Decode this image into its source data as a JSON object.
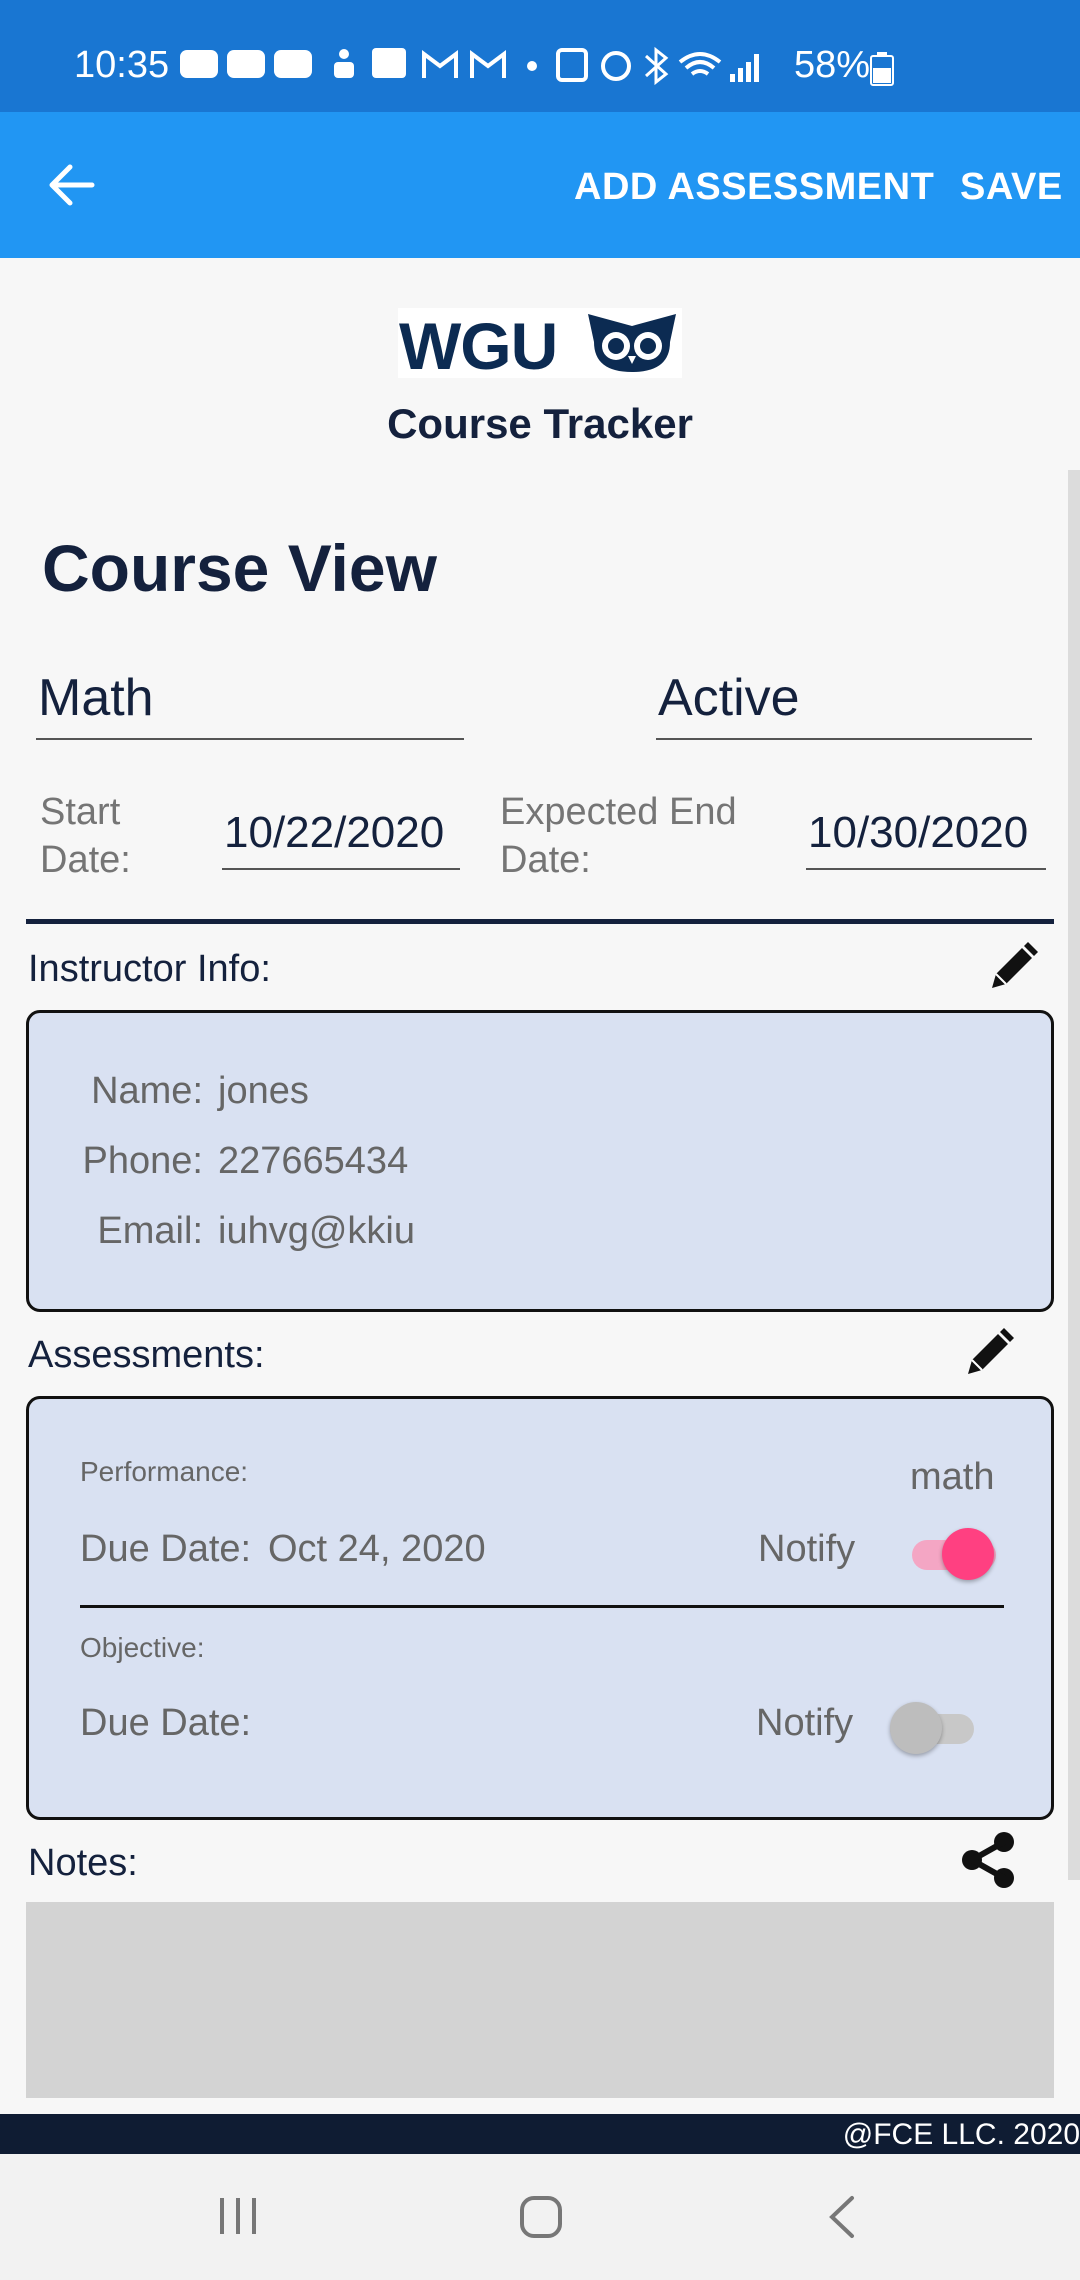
{
  "status_bar": {
    "time": "10:35",
    "notification_icons": [
      "youtube-icon",
      "youtube-icon",
      "youtube-icon",
      "accessibility-icon",
      "message-alert-icon",
      "gmail-icon",
      "gmail-icon",
      "dot-icon",
      "nfc-icon",
      "alarm-icon",
      "bluetooth-icon",
      "wifi-icon",
      "signal-icon"
    ],
    "battery": "58%"
  },
  "app_bar": {
    "add_assessment": "ADD ASSESSMENT",
    "save": "SAVE"
  },
  "header": {
    "logo_text": "WGU",
    "subtitle": "Course Tracker"
  },
  "course": {
    "page_title": "Course View",
    "name": "Math",
    "status": "Active",
    "start_label_1": "Start",
    "start_label_2": "Date:",
    "start_date": "10/22/2020",
    "end_label_1": "Expected End",
    "end_label_2": "Date:",
    "end_date": "10/30/2020"
  },
  "instructor": {
    "section_label": "Instructor Info:",
    "name_label": "Name:",
    "name": "jones",
    "phone_label": "Phone:",
    "phone": "227665434",
    "email_label": "Email:",
    "email": "iuhvg@kkiu"
  },
  "assessments": {
    "section_label": "Assessments:",
    "items": [
      {
        "type": "Performance:",
        "title": "math",
        "due_label": "Due Date:",
        "due_date": "Oct 24, 2020",
        "notify_label": "Notify",
        "notify_on": true
      },
      {
        "type": "Objective:",
        "title": "",
        "due_label": "Due Date:",
        "due_date": "",
        "notify_label": "Notify",
        "notify_on": false
      }
    ]
  },
  "notes": {
    "section_label": "Notes:",
    "text": ""
  },
  "footer": {
    "copyright": "@FCE LLC. 2020"
  },
  "colors": {
    "status_bar": "#1976d2",
    "app_bar": "#2196f3",
    "navy": "#14213d",
    "card_bg": "#d9e1f2",
    "toggle_on": "#ff4081"
  }
}
